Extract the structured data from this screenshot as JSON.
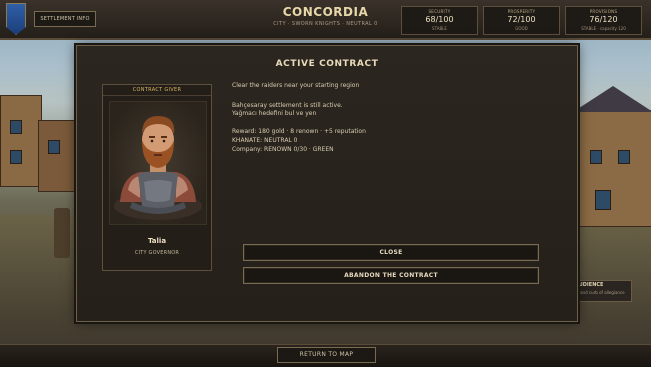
{
  "topbar": {
    "info_button": "SETTLEMENT INFO",
    "title": "CONCORDIA",
    "subtitle": "CITY · SWORN KNIGHTS · NEUTRAL 0",
    "stats": [
      {
        "label": "SECURITY",
        "value": "68/100",
        "sub": "STABLE"
      },
      {
        "label": "PROSPERITY",
        "value": "72/100",
        "sub": "GOOD"
      },
      {
        "label": "PROVISIONS",
        "value": "76/120",
        "sub": "STABLE · capacity 120"
      }
    ]
  },
  "modal": {
    "title": "ACTIVE CONTRACT",
    "giver": {
      "header": "CONTRACT GIVER",
      "name": "Talia",
      "role": "CITY GOVERNOR"
    },
    "objective": "Clear the raiders near your starting region",
    "status_line1": "Bahçesaray settlement is still active.",
    "status_line2": "Yağmacı hedefini bul ve yen",
    "reward": "Reward: 180 gold · 8 renown · +5 reputation",
    "khanate": "KHANATE: NEUTRAL 0",
    "company": "Company: RENOWN 0/30 · GREEN",
    "close_button": "CLOSE",
    "abandon_button": "ABANDON THE CONTRACT"
  },
  "side_panel": {
    "title": "AUDIENCE",
    "text": "... and curb of allegiance"
  },
  "bottombar": {
    "map_button": "RETURN TO MAP"
  },
  "colors": {
    "accent_gold": "#d7b467",
    "panel_bg": "#2b261f",
    "border": "#6e5f49"
  }
}
